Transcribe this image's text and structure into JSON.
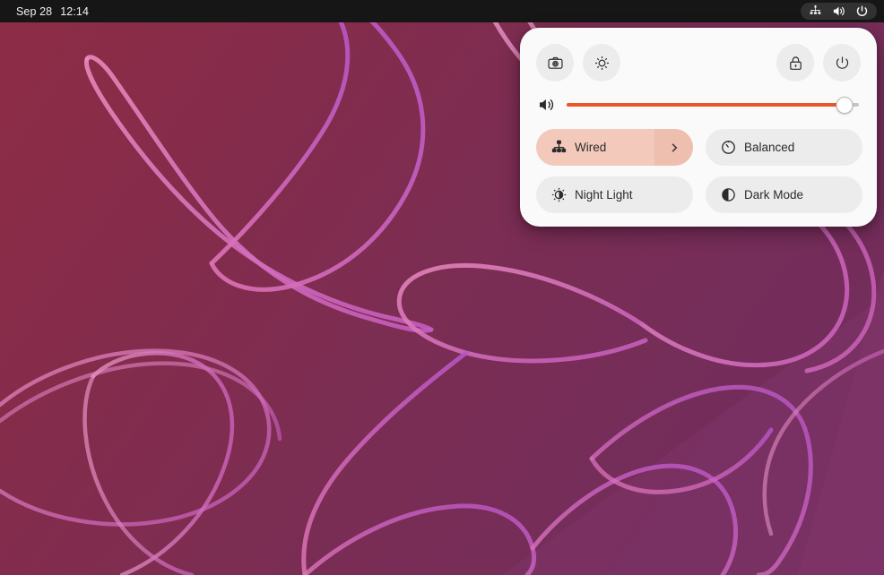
{
  "topbar": {
    "clock": {
      "date": "Sep 28",
      "time": "12:14"
    },
    "indicators": [
      {
        "name": "wired-network-icon",
        "label": "Wired Network"
      },
      {
        "name": "volume-icon",
        "label": "Volume"
      },
      {
        "name": "power-icon",
        "label": "System Power"
      }
    ]
  },
  "quick_settings": {
    "buttons": [
      {
        "name": "screenshot-button",
        "icon": "camera-icon",
        "label": "Take Screenshot"
      },
      {
        "name": "settings-button",
        "icon": "gear-icon",
        "label": "Settings"
      },
      {
        "name": "lock-button",
        "icon": "lock-icon",
        "label": "Lock Screen"
      },
      {
        "name": "power-button",
        "icon": "power-icon",
        "label": "Power Off / Log Out"
      }
    ],
    "volume": {
      "icon": "volume-high-icon",
      "label": "Volume",
      "value": 95,
      "min": 0,
      "max": 100
    },
    "tiles": [
      {
        "name": "tile-wired",
        "icon": "network-wired-icon",
        "label": "Wired",
        "active": true,
        "has_submenu": true,
        "submenu_icon": "chevron-right-icon"
      },
      {
        "name": "tile-power-profile",
        "icon": "speedometer-icon",
        "label": "Balanced",
        "active": false,
        "has_submenu": false
      },
      {
        "name": "tile-night-light",
        "icon": "night-light-icon",
        "label": "Night Light",
        "active": false,
        "has_submenu": false
      },
      {
        "name": "tile-dark-mode",
        "icon": "dark-mode-icon",
        "label": "Dark Mode",
        "active": false,
        "has_submenu": false
      }
    ]
  },
  "colors": {
    "accent": "#e8572a",
    "panel_bg": "#fafafa",
    "tile_bg": "#ececec",
    "tile_active_bg": "#f3c9bb",
    "topbar_bg": "#161616",
    "wallpaper_start": "#8e2c46",
    "wallpaper_end": "#722e5f",
    "ribbon_pink": "#e06fae"
  }
}
